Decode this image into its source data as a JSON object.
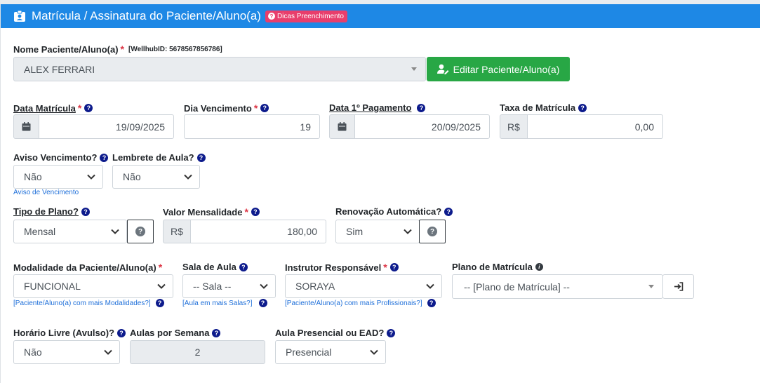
{
  "header": {
    "title": "Matrícula / Assinatura do Paciente/Aluno(a)",
    "tips_badge": "Dicas Preenchimento"
  },
  "patient": {
    "label": "Nome Paciente/Aluno(a)",
    "wellhub": "[WellhubID: 5678567856786]",
    "value": "ALEX FERRARI",
    "edit_button": "Editar Paciente/Aluno(a)"
  },
  "row1": {
    "data_matricula": {
      "label": "Data Matrícula",
      "value": "19/09/2025"
    },
    "dia_vencimento": {
      "label": "Dia Vencimento",
      "value": "19"
    },
    "data_pagamento": {
      "label": "Data 1º Pagamento",
      "value": "20/09/2025"
    },
    "taxa_matricula": {
      "label": "Taxa de Matrícula",
      "prefix": "R$",
      "value": "0,00"
    }
  },
  "row2": {
    "aviso": {
      "label": "Aviso Vencimento?",
      "value": "Não",
      "hint": "Aviso de Vencimento"
    },
    "lembrete": {
      "label": "Lembrete de Aula?",
      "value": "Não"
    }
  },
  "row3": {
    "tipo_plano": {
      "label": "Tipo de Plano?",
      "value": "Mensal"
    },
    "valor_mensalidade": {
      "label": "Valor Mensalidade",
      "prefix": "R$",
      "value": "180,00"
    },
    "renovacao": {
      "label": "Renovação Automática?",
      "value": "Sim"
    }
  },
  "row4": {
    "modalidade": {
      "label": "Modalidade da Paciente/Aluno(a)",
      "value": "FUNCIONAL",
      "hint": "[Paciente/Aluno(a) com mais Modalidades?]"
    },
    "sala": {
      "label": "Sala de Aula",
      "value": "-- Sala --",
      "hint": "[Aula em mais Salas?]"
    },
    "instrutor": {
      "label": "Instrutor Responsável",
      "value": "SORAYA",
      "hint": "[Paciente/Aluno(a) com mais Profissionais?]"
    },
    "plano_matricula": {
      "label": "Plano de Matrícula",
      "value": "-- [Plano de Matrícula] --"
    }
  },
  "row5": {
    "horario_livre": {
      "label": "Horário Livre (Avulso)?",
      "value": "Não"
    },
    "aulas_semana": {
      "label": "Aulas por Semana",
      "value": "2"
    },
    "presencial": {
      "label": "Aula Presencial ou EAD?",
      "value": "Presencial"
    }
  },
  "icons": [
    "id-card-icon",
    "help-icon",
    "user-edit-icon",
    "calendar-icon",
    "chevron-down-icon",
    "info-icon",
    "sign-in-icon"
  ],
  "colors": {
    "header": "#1e88e5",
    "badge": "#e83e6c",
    "green": "#28a745",
    "required": "#dc3545",
    "help": "#0d1b8c"
  }
}
